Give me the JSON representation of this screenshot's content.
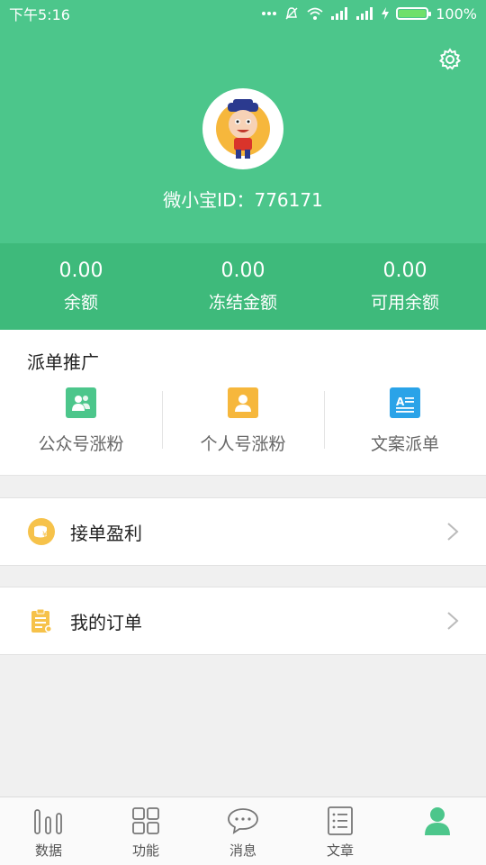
{
  "status_bar": {
    "time": "下午5:16",
    "battery": "100%"
  },
  "header": {
    "user_id": "微小宝ID：776171"
  },
  "balances": [
    {
      "value": "0.00",
      "label": "余额"
    },
    {
      "value": "0.00",
      "label": "冻结金额"
    },
    {
      "value": "0.00",
      "label": "可用余额"
    }
  ],
  "promo": {
    "title": "派单推广",
    "items": [
      {
        "label": "公众号涨粉",
        "icon": "wechat-group-icon",
        "color": "#4cc68b"
      },
      {
        "label": "个人号涨粉",
        "icon": "person-icon",
        "color": "#f6b73c"
      },
      {
        "label": "文案派单",
        "icon": "document-icon",
        "color": "#2aa3e8"
      }
    ]
  },
  "rows": [
    {
      "label": "接单盈利",
      "icon": "coins-icon"
    },
    {
      "label": "我的订单",
      "icon": "clipboard-icon"
    }
  ],
  "tabs": [
    {
      "label": "数据",
      "icon": "bar-chart-icon"
    },
    {
      "label": "功能",
      "icon": "grid-icon"
    },
    {
      "label": "消息",
      "icon": "chat-bubble-icon"
    },
    {
      "label": "文章",
      "icon": "article-icon"
    },
    {
      "label": "",
      "icon": "profile-icon"
    }
  ],
  "colors": {
    "brand_green": "#4cc68b",
    "balance_green": "#3eba7b"
  }
}
